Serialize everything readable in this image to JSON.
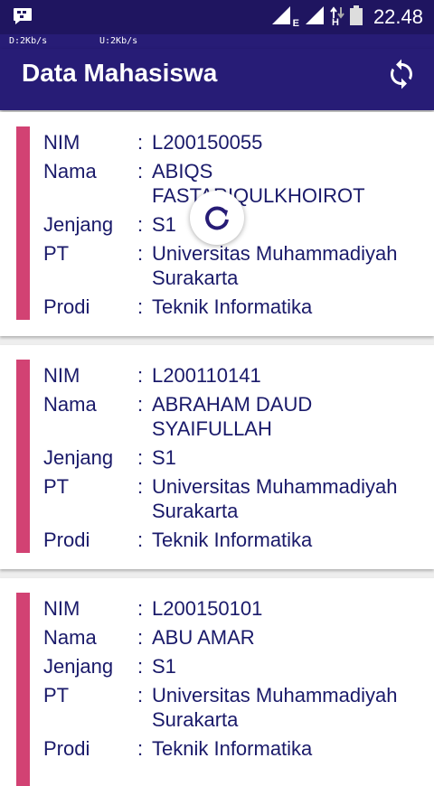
{
  "status_bar": {
    "time": "22.48",
    "network_type": "E",
    "network_type_2": "H"
  },
  "net_speed": {
    "download": "D:2Kb/s",
    "upload": "U:2Kb/s"
  },
  "app_bar": {
    "title": "Data Mahasiswa"
  },
  "labels": {
    "nim": "NIM",
    "nama": "Nama",
    "jenjang": "Jenjang",
    "pt": "PT",
    "prodi": "Prodi",
    "colon": ":"
  },
  "students": [
    {
      "nim": "L200150055",
      "nama": "ABIQS FASTARIQULKHOIROT",
      "jenjang": "S1",
      "pt": "Universitas Muhammadiyah Surakarta",
      "prodi": "Teknik Informatika"
    },
    {
      "nim": "L200110141",
      "nama": "ABRAHAM DAUD SYAIFULLAH",
      "jenjang": "S1",
      "pt": "Universitas Muhammadiyah Surakarta",
      "prodi": "Teknik Informatika"
    },
    {
      "nim": "L200150101",
      "nama": "ABU AMAR",
      "jenjang": "S1",
      "pt": "Universitas Muhammadiyah Surakarta",
      "prodi": "Teknik Informatika"
    }
  ],
  "icons": {
    "notification": "bbm-chat-icon",
    "refresh": "sync-icon",
    "loading": "loading-spinner-icon"
  },
  "colors": {
    "app_bar": "#271c76",
    "status_bar": "#1f1560",
    "accent": "#d24273",
    "text": "#1a1a6a"
  }
}
